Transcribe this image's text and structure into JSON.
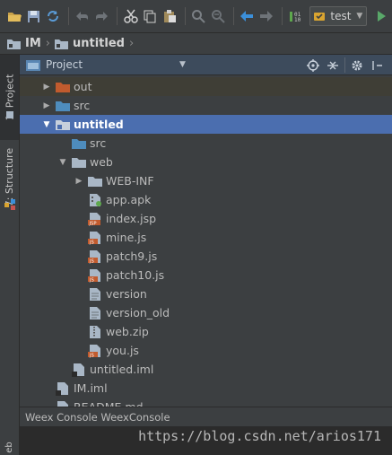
{
  "toolbar": {
    "buttons": [
      "open-icon",
      "save-icon",
      "sync-icon",
      "undo-icon",
      "redo-icon",
      "cut-icon",
      "copy-icon",
      "paste-icon",
      "find-icon",
      "replace-icon",
      "back-icon",
      "forward-icon",
      "build-icon"
    ],
    "run_config": "test"
  },
  "navbar": {
    "crumbs": [
      "IM",
      "untitled"
    ]
  },
  "stripe": {
    "project_tab": "1: Project",
    "structure_tab": "7: Structure",
    "bottom_tab": "eb"
  },
  "panel": {
    "title": "Project"
  },
  "tree": [
    {
      "label": "out",
      "depth": 1,
      "arrow": "right",
      "icon": "folder-orange-icon",
      "state": "dim"
    },
    {
      "label": "src",
      "depth": 1,
      "arrow": "right",
      "icon": "folder-blue-icon",
      "state": ""
    },
    {
      "label": "untitled",
      "depth": 1,
      "arrow": "down",
      "icon": "module-folder-icon",
      "state": "sel"
    },
    {
      "label": "src",
      "depth": 2,
      "arrow": "",
      "icon": "folder-blue-icon",
      "state": ""
    },
    {
      "label": "web",
      "depth": 2,
      "arrow": "down",
      "icon": "folder-icon",
      "state": ""
    },
    {
      "label": "WEB-INF",
      "depth": 3,
      "arrow": "right",
      "icon": "folder-icon",
      "state": ""
    },
    {
      "label": "app.apk",
      "depth": 3,
      "arrow": "",
      "icon": "apk-file-icon",
      "state": ""
    },
    {
      "label": "index.jsp",
      "depth": 3,
      "arrow": "",
      "icon": "jsp-file-icon",
      "state": ""
    },
    {
      "label": "mine.js",
      "depth": 3,
      "arrow": "",
      "icon": "js-file-icon",
      "state": ""
    },
    {
      "label": "patch9.js",
      "depth": 3,
      "arrow": "",
      "icon": "js-file-icon",
      "state": ""
    },
    {
      "label": "patch10.js",
      "depth": 3,
      "arrow": "",
      "icon": "js-file-icon",
      "state": ""
    },
    {
      "label": "version",
      "depth": 3,
      "arrow": "",
      "icon": "text-file-icon",
      "state": ""
    },
    {
      "label": "version_old",
      "depth": 3,
      "arrow": "",
      "icon": "text-file-icon",
      "state": ""
    },
    {
      "label": "web.zip",
      "depth": 3,
      "arrow": "",
      "icon": "zip-file-icon",
      "state": ""
    },
    {
      "label": "you.js",
      "depth": 3,
      "arrow": "",
      "icon": "js-file-icon",
      "state": ""
    },
    {
      "label": "untitled.iml",
      "depth": 2,
      "arrow": "",
      "icon": "iml-file-icon",
      "state": ""
    },
    {
      "label": "IM.iml",
      "depth": 1,
      "arrow": "",
      "icon": "iml-file-icon",
      "state": ""
    },
    {
      "label": "README.md",
      "depth": 1,
      "arrow": "",
      "icon": "md-file-icon",
      "state": ""
    }
  ],
  "bottom": {
    "tabs_label": "Weex Console WeexConsole"
  },
  "watermark": "https://blog.csdn.net/arios171",
  "colors": {
    "selection": "#4b6eaf",
    "background": "#3c3f41",
    "header": "#3d4b5c"
  }
}
